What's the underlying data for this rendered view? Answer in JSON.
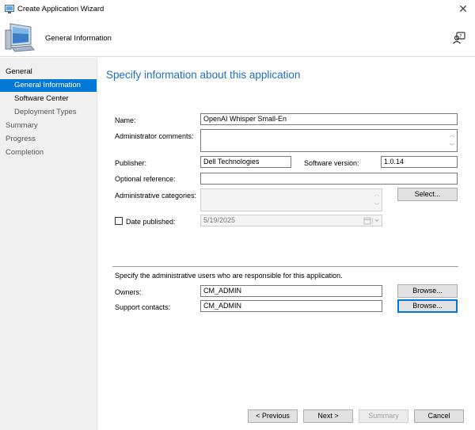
{
  "window": {
    "title": "Create Application Wizard",
    "close_label": "✕"
  },
  "header": {
    "title": "General Information"
  },
  "nav": {
    "general": "General",
    "general_information": "General Information",
    "software_center": "Software Center",
    "deployment_types": "Deployment Types",
    "summary": "Summary",
    "progress": "Progress",
    "completion": "Completion"
  },
  "page": {
    "heading": "Specify information about this application",
    "name_label": "Name:",
    "name_value": "OpenAI Whisper Small-En",
    "admin_comments_label": "Administrator comments:",
    "admin_comments_value": "",
    "publisher_label": "Publisher:",
    "publisher_value": "Dell Technologies",
    "software_version_label": "Software version:",
    "software_version_value": "1.0.14",
    "optional_reference_label": "Optional reference:",
    "optional_reference_value": "",
    "admin_categories_label": "Administrative categories:",
    "select_button": "Select...",
    "date_published_label": "Date published:",
    "date_published_value": "5/19/2025",
    "date_published_checked": false,
    "admin_users_text": "Specify the administrative users who are responsible for this application.",
    "owners_label": "Owners:",
    "owners_value": "CM_ADMIN",
    "support_contacts_label": "Support contacts:",
    "support_contacts_value": "CM_ADMIN",
    "browse_label": "Browse..."
  },
  "footer": {
    "previous": "< Previous",
    "next": "Next >",
    "summary": "Summary",
    "cancel": "Cancel"
  },
  "colors": {
    "accent": "#0078d7",
    "heading": "#1e6fc0"
  }
}
